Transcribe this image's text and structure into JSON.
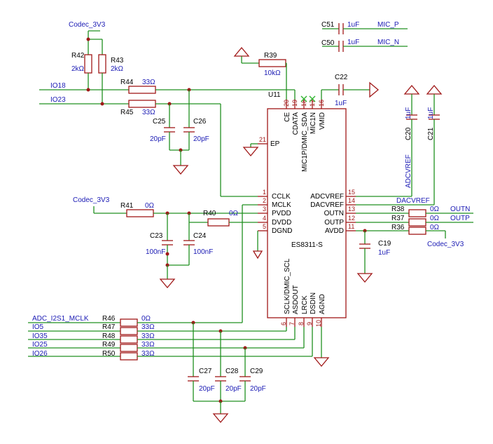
{
  "ic": {
    "ref": "U11",
    "part": "ES8311-S",
    "left_pins": [
      {
        "num": "21",
        "name": "EP"
      },
      {
        "num": "1",
        "name": "CCLK"
      },
      {
        "num": "2",
        "name": "MCLK"
      },
      {
        "num": "3",
        "name": "PVDD"
      },
      {
        "num": "4",
        "name": "DVDD"
      },
      {
        "num": "5",
        "name": "DGND"
      }
    ],
    "right_pins": [
      {
        "num": "15",
        "name": "ADCVREF"
      },
      {
        "num": "14",
        "name": "DACVREF"
      },
      {
        "num": "13",
        "name": "OUTN"
      },
      {
        "num": "12",
        "name": "OUTP"
      },
      {
        "num": "11",
        "name": "AVDD"
      }
    ],
    "top_pins": [
      {
        "num": "20",
        "name": "CE"
      },
      {
        "num": "19",
        "name": "CDATA"
      },
      {
        "num": "18",
        "name": "MIC1P/DMIC_SDA"
      },
      {
        "num": "17",
        "name": "MIC1N"
      },
      {
        "num": "16",
        "name": "VMID"
      }
    ],
    "bottom_pins": [
      {
        "num": "6",
        "name": "SCLK/DMIC_SCL"
      },
      {
        "num": "7",
        "name": "ASDOUT"
      },
      {
        "num": "8",
        "name": "LRCK"
      },
      {
        "num": "9",
        "name": "DSDIN"
      },
      {
        "num": "10",
        "name": "AGND"
      }
    ]
  },
  "resistors": [
    {
      "ref": "R42",
      "value": "2kΩ"
    },
    {
      "ref": "R43",
      "value": "2kΩ"
    },
    {
      "ref": "R44",
      "value": "33Ω"
    },
    {
      "ref": "R45",
      "value": "33Ω"
    },
    {
      "ref": "R39",
      "value": "10kΩ"
    },
    {
      "ref": "R41",
      "value": "0Ω"
    },
    {
      "ref": "R40",
      "value": "0Ω"
    },
    {
      "ref": "R38",
      "value": "0Ω"
    },
    {
      "ref": "R37",
      "value": "0Ω"
    },
    {
      "ref": "R36",
      "value": "0Ω"
    },
    {
      "ref": "R46",
      "value": "0Ω"
    },
    {
      "ref": "R47",
      "value": "33Ω"
    },
    {
      "ref": "R48",
      "value": "33Ω"
    },
    {
      "ref": "R49",
      "value": "33Ω"
    },
    {
      "ref": "R50",
      "value": "33Ω"
    }
  ],
  "capacitors": [
    {
      "ref": "C51",
      "value": "1uF"
    },
    {
      "ref": "C50",
      "value": "1uF"
    },
    {
      "ref": "C22",
      "value": "1uF"
    },
    {
      "ref": "C25",
      "value": "20pF"
    },
    {
      "ref": "C26",
      "value": "20pF"
    },
    {
      "ref": "C23",
      "value": "100nF"
    },
    {
      "ref": "C24",
      "value": "100nF"
    },
    {
      "ref": "C20",
      "value": "1uF"
    },
    {
      "ref": "C21",
      "value": "1uF"
    },
    {
      "ref": "C19",
      "value": "1uF"
    },
    {
      "ref": "C29",
      "value": "20pF"
    },
    {
      "ref": "C28",
      "value": "20pF"
    },
    {
      "ref": "C27",
      "value": "20pF"
    }
  ],
  "nets": {
    "codec_3v3_top": "Codec_3V3",
    "codec_3v3_left": "Codec_3V3",
    "codec_3v3_right": "Codec_3V3",
    "io18": "IO18",
    "io23": "IO23",
    "mic_p": "MIC_P",
    "mic_n": "MIC_N",
    "outn": "OUTN",
    "outp": "OUTP",
    "adcvref": "ADCVREF",
    "dacvref": "DACVREF",
    "adc_mclk": "ADC_I2S1_MCLK",
    "io5": "IO5",
    "io35": "IO35",
    "io25": "IO25",
    "io26": "IO26"
  }
}
